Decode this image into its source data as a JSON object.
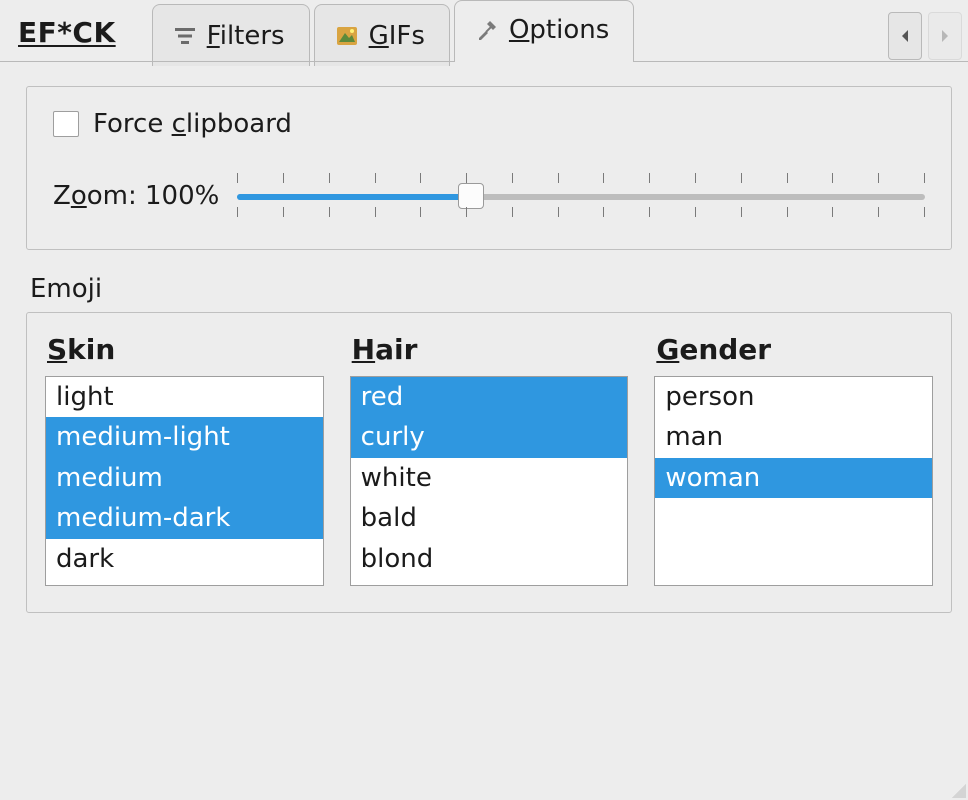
{
  "app": {
    "title": "EF*CK"
  },
  "tabs": [
    {
      "label": "Filters",
      "accel": "F",
      "rest": "ilters",
      "icon": "filters-icon",
      "active": false
    },
    {
      "label": "GIFs",
      "accel": "G",
      "rest": "IFs",
      "icon": "gifs-icon",
      "active": false
    },
    {
      "label": "Options",
      "accel": "O",
      "rest": "ptions",
      "icon": "tools-icon",
      "active": true
    }
  ],
  "nav": {
    "prev_enabled": true,
    "next_enabled": false
  },
  "options": {
    "force_clipboard": {
      "label_prefix": "Force ",
      "accel": "c",
      "label_suffix": "lipboard",
      "checked": false
    },
    "zoom": {
      "label_prefix": "Z",
      "accel": "o",
      "label_suffix": "om:",
      "value_text": "100%",
      "percent": 34
    }
  },
  "emoji": {
    "section_label": "Emoji",
    "columns": [
      {
        "key": "skin",
        "label_accel": "S",
        "label_rest": "kin",
        "items": [
          "light",
          "medium-light",
          "medium",
          "medium-dark",
          "dark"
        ],
        "selected": [
          "medium-light",
          "medium",
          "medium-dark"
        ]
      },
      {
        "key": "hair",
        "label_accel": "H",
        "label_rest": "air",
        "items": [
          "red",
          "curly",
          "white",
          "bald",
          "blond"
        ],
        "selected": [
          "red",
          "curly"
        ]
      },
      {
        "key": "gender",
        "label_accel": "G",
        "label_rest": "ender",
        "items": [
          "person",
          "man",
          "woman"
        ],
        "selected": [
          "woman"
        ]
      }
    ]
  }
}
